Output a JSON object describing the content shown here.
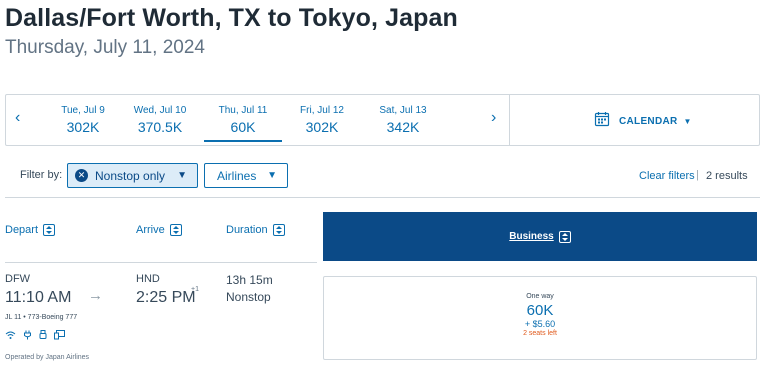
{
  "header": {
    "title": "Dallas/Fort Worth, TX to Tokyo, Japan",
    "date": "Thursday, July 11, 2024"
  },
  "datebar": {
    "prev_arrow": "‹",
    "next_arrow": "›",
    "days": [
      {
        "label": "Tue, Jul 9",
        "price": "302K"
      },
      {
        "label": "Wed, Jul 10",
        "price": "370.5K"
      },
      {
        "label": "Thu, Jul 11",
        "price": "60K",
        "selected": true
      },
      {
        "label": "Fri, Jul 12",
        "price": "302K"
      },
      {
        "label": "Sat, Jul 13",
        "price": "342K"
      }
    ],
    "calendar_label": "CALENDAR",
    "calendar_icon": "calendar-icon"
  },
  "filters": {
    "label": "Filter by:",
    "chips": [
      {
        "label": "Nonstop only",
        "active": true
      },
      {
        "label": "Airlines",
        "active": false
      }
    ],
    "clear_label": "Clear filters",
    "separator": "|",
    "results": "2 results"
  },
  "columns": {
    "depart": "Depart",
    "arrive": "Arrive",
    "duration": "Duration",
    "business": "Business"
  },
  "flight": {
    "origin": "DFW",
    "depart_time": "11:10 AM",
    "destination": "HND",
    "arrive_time": "2:25 PM",
    "day_offset": "+1",
    "duration": "13h 15m",
    "stops": "Nonstop",
    "flight_info": "JL 11 • 773-Boeing 777",
    "amenities": [
      "wifi-icon",
      "power-icon",
      "usb-icon",
      "entertainment-icon"
    ],
    "operated_by": "Operated by Japan Airlines",
    "fare": {
      "trip_type": "One way",
      "points": "60K",
      "taxes": "+ $5.60",
      "seats_left": "2 seats left"
    }
  },
  "colors": {
    "accent": "#0b6fb0",
    "business_header": "#0b4a87",
    "seats_warning": "#e05a1c"
  }
}
